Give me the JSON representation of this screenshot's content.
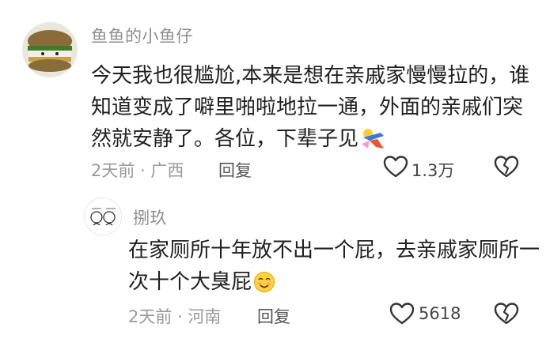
{
  "comment": {
    "username": "鱼鱼的小鱼仔",
    "text": "今天我也很尴尬,本来是想在亲戚家慢慢拉的，谁知道变成了噼里啪啦地拉一通，外面的亲戚们突然就安静了。各位，下辈子见",
    "time": "2天前",
    "location": "广西",
    "reply_label": "回复",
    "likes": "1.3万"
  },
  "reply": {
    "username": "捌玖",
    "text": "在家厕所十年放不出一个屁，去亲戚家厕所一次十个大臭屁",
    "time": "2天前",
    "location": "河南",
    "reply_label": "回复",
    "likes": "5618"
  },
  "separator": " · "
}
